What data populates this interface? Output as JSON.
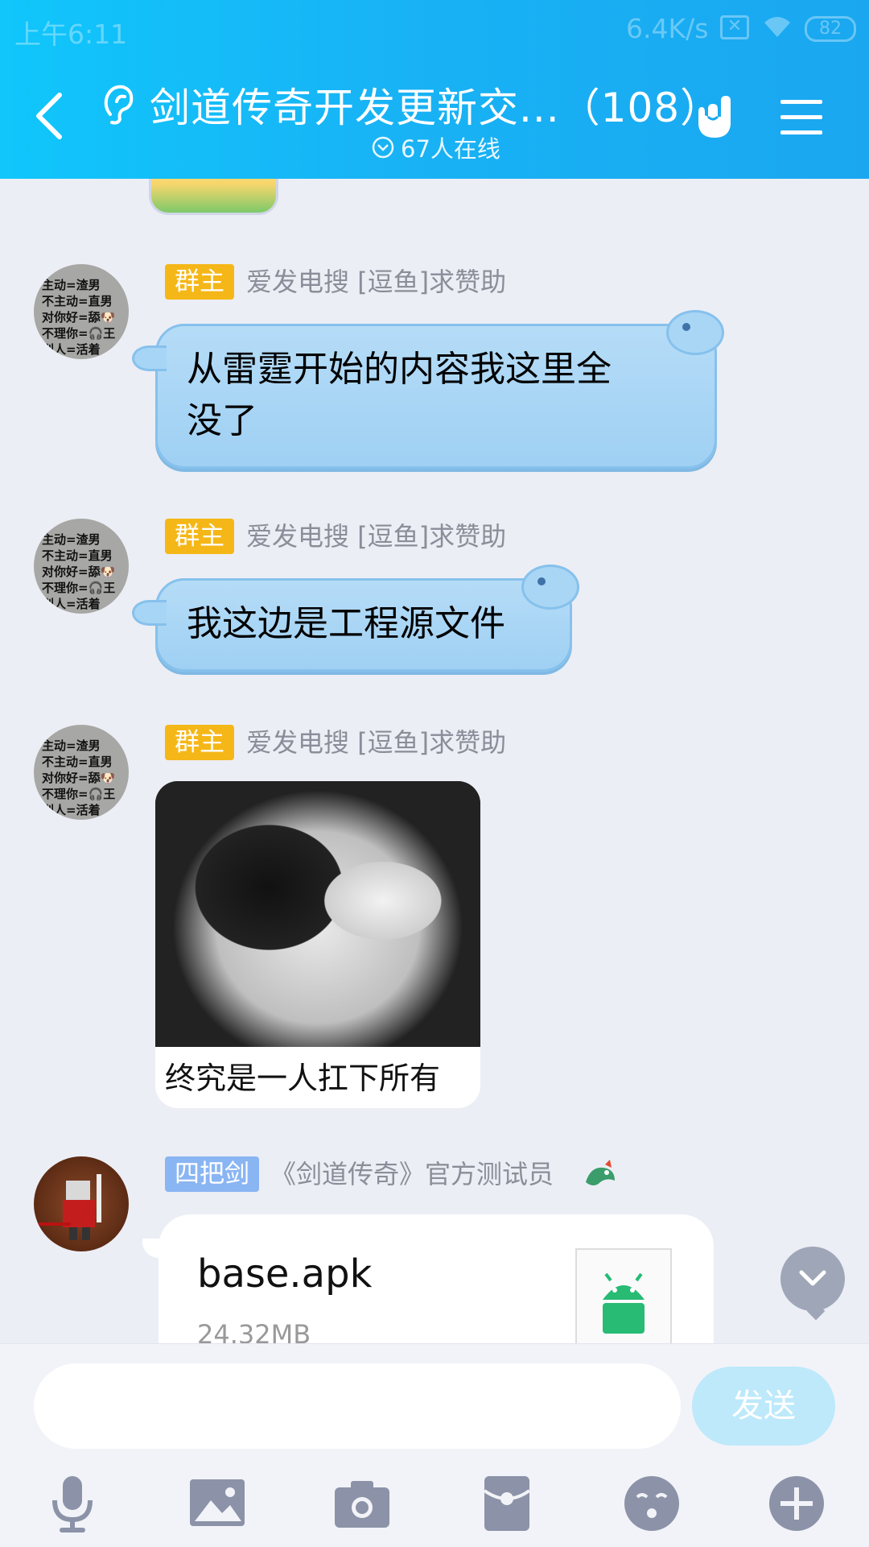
{
  "status_bar": {
    "time": "上午6:11",
    "speed": "6.4K/s",
    "battery": "82"
  },
  "header": {
    "title": "剑道传奇开发更新交...（108）",
    "online": "67人在线"
  },
  "messages": [
    {
      "badge": "群主",
      "sender": "爱发电搜 [逗鱼]求赞助",
      "text_line1": "从雷霆开始的内容我这里全",
      "text_line2": "没了"
    },
    {
      "badge": "群主",
      "sender": "爱发电搜 [逗鱼]求赞助",
      "text": "我这边是工程源文件"
    },
    {
      "badge": "群主",
      "sender": "爱发电搜 [逗鱼]求赞助",
      "image_caption": "终究是一人扛下所有"
    },
    {
      "badge": "四把剑",
      "sender": "《剑道传奇》官方测试员",
      "file_name": "base.apk",
      "file_size": "24.32MB"
    }
  ],
  "avatar_text": "主动=渣男\n不主动=直男\n对你好=舔🐶\n不理你=🎧王\n别人=活着",
  "input": {
    "placeholder": "",
    "send_label": "发送"
  },
  "colors": {
    "header": "#18b3f5",
    "bubble": "#a9d6f5",
    "owner_badge": "#f5b718",
    "member_badge": "#8ab5f3"
  }
}
